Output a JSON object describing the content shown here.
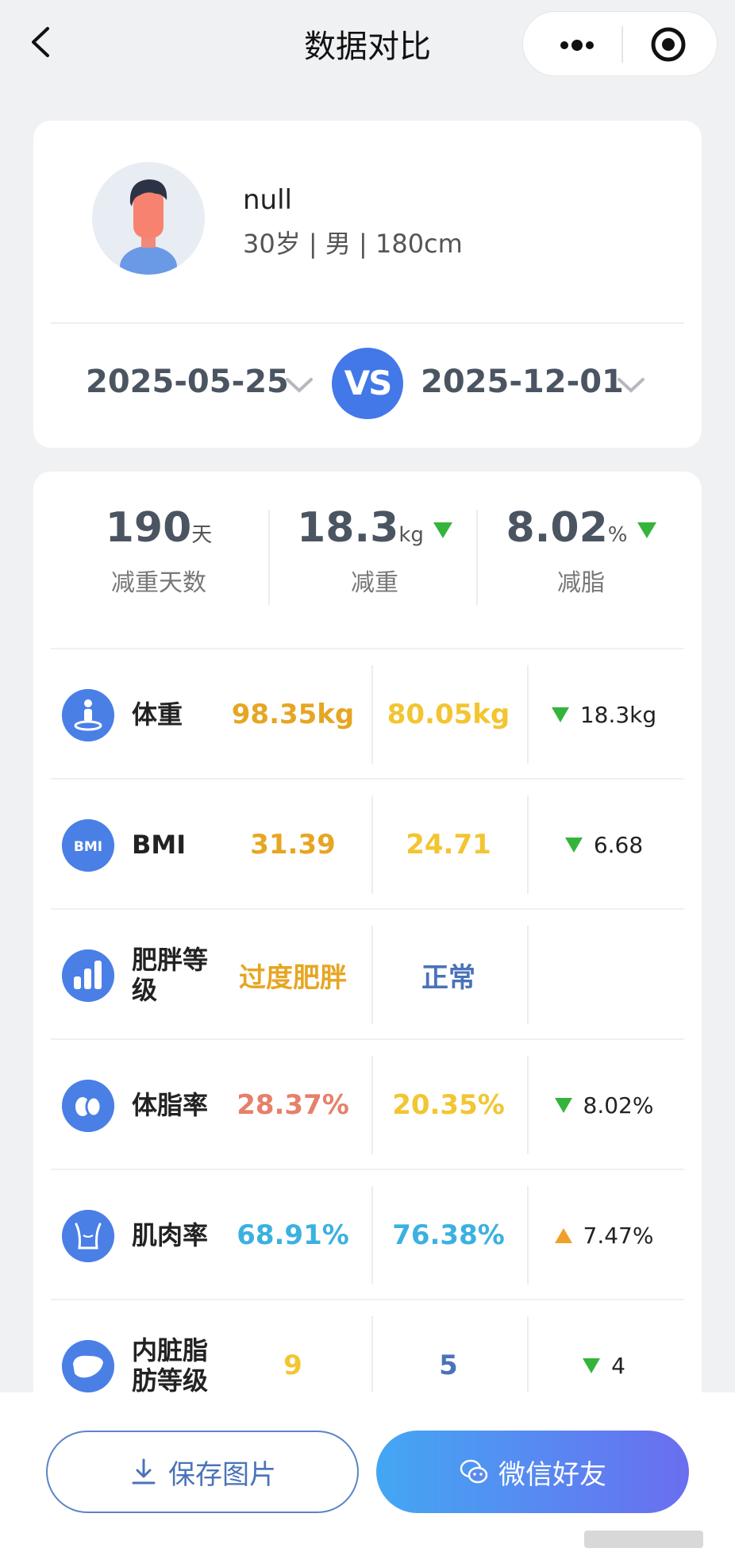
{
  "nav": {
    "title": "数据对比",
    "back_icon": "back-arrow-icon",
    "more_icon": "more-dots-icon",
    "close_icon": "target-circle-icon"
  },
  "profile": {
    "name": "null",
    "info": "30岁 | 男 | 180cm",
    "avatar_icon": "user-avatar-icon"
  },
  "dates": {
    "start": "2025-05-25",
    "vs": "VS",
    "end": "2025-12-01"
  },
  "summary": [
    {
      "value": "190",
      "unit": "天",
      "label": "减重天数",
      "trend": ""
    },
    {
      "value": "18.3",
      "unit": "kg",
      "label": "减重",
      "trend": "down"
    },
    {
      "value": "8.02",
      "unit": "%",
      "label": "减脂",
      "trend": "down"
    }
  ],
  "rows": [
    {
      "icon": "weight-icon",
      "label": "体重",
      "v1": "98.35kg",
      "v2": "80.05kg",
      "diff": "18.3kg",
      "trend": "down",
      "v1_color": "#e6a623",
      "v2_color": "#f2c531"
    },
    {
      "icon": "bmi-icon",
      "label": "BMI",
      "v1": "31.39",
      "v2": "24.71",
      "diff": "6.68",
      "trend": "down",
      "v1_color": "#e6a623",
      "v2_color": "#f2c531"
    },
    {
      "icon": "bar-chart-icon",
      "label": "肥胖等级",
      "v1": "过度肥胖",
      "v2": "正常",
      "diff": "",
      "trend": "",
      "v1_color": "#e6a623",
      "v2_color": "#4a73b8"
    },
    {
      "icon": "body-fat-icon",
      "label": "体脂率",
      "v1": "28.37%",
      "v2": "20.35%",
      "diff": "8.02%",
      "trend": "down",
      "v1_color": "#e6806a",
      "v2_color": "#f2c531"
    },
    {
      "icon": "muscle-icon",
      "label": "肌肉率",
      "v1": "68.91%",
      "v2": "76.38%",
      "diff": "7.47%",
      "trend": "up",
      "v1_color": "#3bb1e0",
      "v2_color": "#3bb1e0"
    },
    {
      "icon": "liver-icon",
      "label": "内脏脂肪等级",
      "v1": "9",
      "v2": "5",
      "diff": "4",
      "trend": "down",
      "v1_color": "#f2c531",
      "v2_color": "#4a73b8"
    }
  ],
  "buttons": {
    "save": "保存图片",
    "wechat": "微信好友"
  },
  "colors": {
    "accent": "#4a7fe6",
    "down": "#35b43c",
    "up": "#f0a02a"
  }
}
